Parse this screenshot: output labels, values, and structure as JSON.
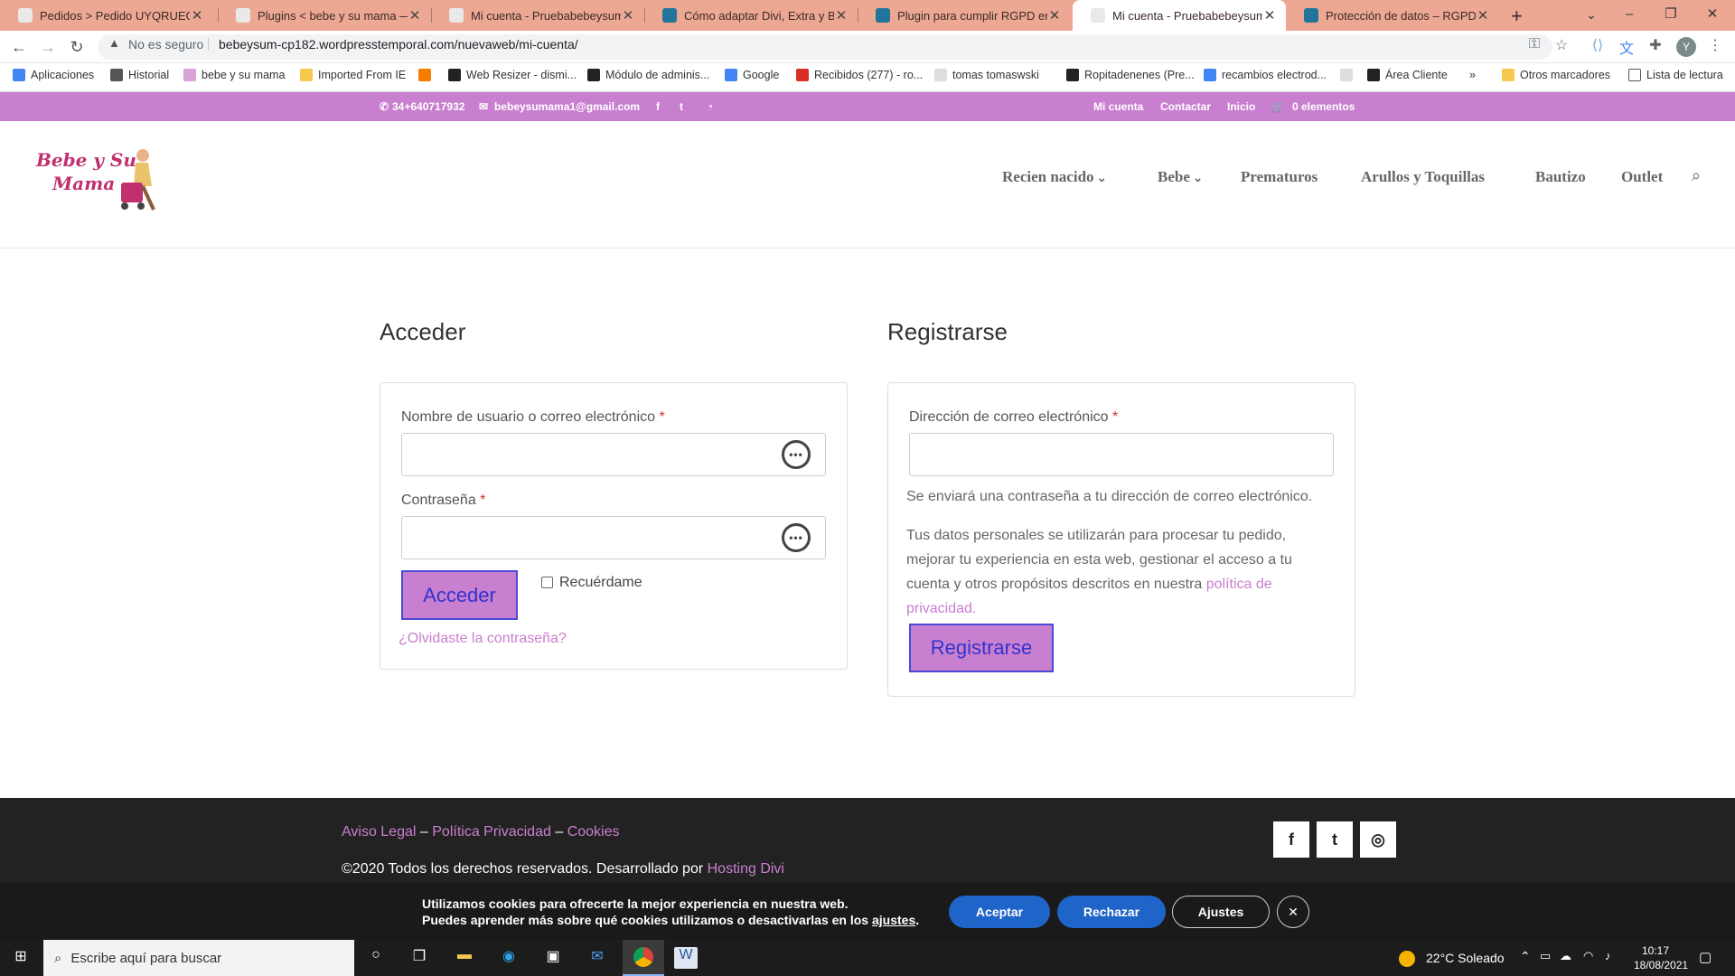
{
  "browser": {
    "tabs": [
      {
        "title": "Pedidos > Pedido UYQRUEGYV",
        "favicon": "page-icon",
        "color": "#e9e9e9"
      },
      {
        "title": "Plugins < bebe y su mama — W",
        "favicon": "bebe-icon",
        "color": "#e9e9e9"
      },
      {
        "title": "Mi cuenta - Pruebabebeysuman",
        "favicon": "bebe-icon",
        "color": "#e9e9e9"
      },
      {
        "title": "Cómo adaptar Divi, Extra y Bloom",
        "favicon": "wordpress-icon",
        "color": "#21759b"
      },
      {
        "title": "Plugin para cumplir RGPD en Di",
        "favicon": "wordpress-icon",
        "color": "#21759b"
      },
      {
        "title": "Mi cuenta - Pruebabebeysuman",
        "favicon": "bebe-icon",
        "color": "#e9e9e9",
        "active": true
      },
      {
        "title": "Protección de datos – RGPD – Pl",
        "favicon": "wordpress-icon",
        "color": "#21759b"
      }
    ],
    "new_tab": "+",
    "window_buttons": [
      "–",
      "❐",
      "✕"
    ],
    "not_secure": "No es seguro",
    "url": "bebeysum-cp182.wordpresstemporal.com/nuevaweb/mi-cuenta/",
    "profile_initial": "Y",
    "bookmarks": [
      {
        "label": "Aplicaciones",
        "icon": "apps-grid-icon",
        "color": "#4285f4"
      },
      {
        "label": "Historial",
        "icon": "history-icon",
        "color": "#555"
      },
      {
        "label": "bebe y su mama",
        "icon": "bebe-icon",
        "color": "#d9a3d9"
      },
      {
        "label": "Imported From IE",
        "icon": "folder-icon",
        "color": "#f6c94e"
      },
      {
        "label": "",
        "icon": "blogger-icon",
        "color": "#f57d00"
      },
      {
        "label": "Web Resizer - dismi...",
        "icon": "resizer-icon",
        "color": "#222"
      },
      {
        "label": "Módulo de adminis...",
        "icon": "globe-icon",
        "color": "#222"
      },
      {
        "label": "Google",
        "icon": "google-icon",
        "color": "#4285f4"
      },
      {
        "label": "Recibidos (277) - ro...",
        "icon": "gmail-icon",
        "color": "#d93025"
      },
      {
        "label": "tomas tomaswski",
        "icon": "page-icon",
        "color": "#ddd"
      },
      {
        "label": "Ropitadenenes (Pre...",
        "icon": "globe-icon",
        "color": "#222"
      },
      {
        "label": "recambios electrod...",
        "icon": "google-icon",
        "color": "#4285f4"
      },
      {
        "label": "",
        "icon": "page-icon",
        "color": "#ddd"
      },
      {
        "label": "Área Cliente",
        "icon": "globe-icon",
        "color": "#222"
      }
    ],
    "bookmarks_more": "»",
    "other_bookmarks": "Otros marcadores",
    "reading_list": "Lista de lectura"
  },
  "site": {
    "topbar": {
      "phone": "34+640717932",
      "email": "bebeysumama1@gmail.com",
      "links": [
        "Mi cuenta",
        "Contactar",
        "Inicio"
      ],
      "cart": "0 elementos"
    },
    "logo_text": [
      "Bebe y Su",
      "Mama"
    ],
    "menu": [
      {
        "label": "Recien nacido",
        "dropdown": true
      },
      {
        "label": "Bebe",
        "dropdown": true
      },
      {
        "label": "Prematuros",
        "dropdown": false
      },
      {
        "label": "Arullos y Toquillas",
        "dropdown": false
      },
      {
        "label": "Bautizo",
        "dropdown": false
      },
      {
        "label": "Outlet",
        "dropdown": false
      }
    ],
    "login": {
      "title": "Acceder",
      "username_label": "Nombre de usuario o correo electrónico",
      "password_label": "Contraseña",
      "required_mark": "*",
      "submit": "Acceder",
      "remember": "Recuérdame",
      "forgot": "¿Olvidaste la contraseña?"
    },
    "register": {
      "title": "Registrarse",
      "email_label": "Dirección de correo electrónico",
      "required_mark": "*",
      "note": "Se enviará una contraseña a tu dirección de correo electrónico.",
      "privacy_text": "Tus datos personales se utilizarán para procesar tu pedido, mejorar tu experiencia en esta web, gestionar el acceso a tu cuenta y otros propósitos descritos en nuestra",
      "privacy_link": "política de privacidad",
      "privacy_end": ".",
      "submit": "Registrarse"
    },
    "footer": {
      "links": [
        "Aviso Legal",
        "Política Privacidad",
        "Cookies"
      ],
      "sep": "–",
      "copyright": "©2020 Todos los derechos reservados. Desarrollado por",
      "credit": "Hosting Divi",
      "social": [
        {
          "name": "facebook-icon",
          "glyph": "f"
        },
        {
          "name": "twitter-icon",
          "glyph": "t"
        },
        {
          "name": "instagram-icon",
          "glyph": "◎"
        }
      ]
    },
    "cookies": {
      "line1": "Utilizamos cookies para ofrecerte la mejor experiencia en nuestra web.",
      "line2": "Puedes aprender más sobre qué cookies utilizamos o desactivarlas en los",
      "line2_link": "ajustes",
      "line2_end": ".",
      "accept": "Aceptar",
      "reject": "Rechazar",
      "settings": "Ajustes",
      "close": "✕"
    }
  },
  "taskbar": {
    "search_placeholder": "Escribe aquí para buscar",
    "weather": "22°C  Soleado",
    "time": "10:17",
    "date": "18/08/2021"
  },
  "colors": {
    "accent": "#c97fcf",
    "tabstrip": "#eda894",
    "footer": "#222222",
    "button_border": "#4a4ad6"
  }
}
